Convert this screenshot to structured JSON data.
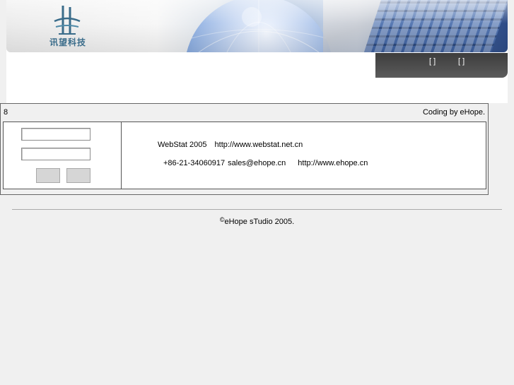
{
  "header": {
    "logo_text": "讯望科技",
    "nav": [
      "[ ]",
      "[ ]"
    ]
  },
  "main": {
    "counter": "8",
    "credit": "Coding by eHope.",
    "login": {
      "username_value": "",
      "password_value": ""
    },
    "info": {
      "product": "WebStat 2005",
      "product_url": "http://www.webstat.net.cn",
      "phone": "+86-21-34060917",
      "email": "sales@ehope.cn",
      "company_url": "http://www.ehope.cn"
    }
  },
  "footer": {
    "copyright_symbol": "©",
    "copyright_text": "eHope sTudio 2005."
  }
}
